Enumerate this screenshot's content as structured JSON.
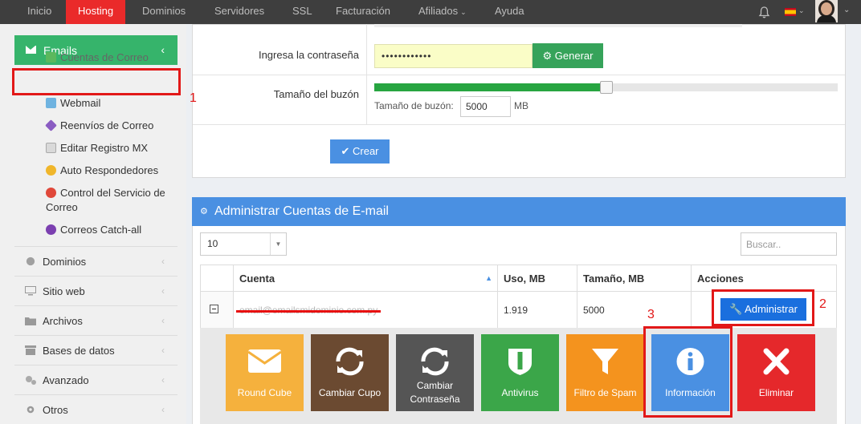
{
  "topnav": {
    "items": [
      "Inicio",
      "Hosting",
      "Dominios",
      "Servidores",
      "SSL",
      "Facturación",
      "Afiliados",
      "Ayuda"
    ],
    "active": "Hosting"
  },
  "sidebar": {
    "section": "Emails",
    "subitems": [
      "Cuentas de Correo",
      "Webmail",
      "Reenvíos de Correo",
      "Editar Registro MX",
      "Auto Respondedores",
      "Control del Servicio de Correo",
      "Correos Catch-all"
    ],
    "items": [
      "Dominios",
      "Sitio web",
      "Archivos",
      "Bases de datos",
      "Avanzado",
      "Otros"
    ]
  },
  "form": {
    "password_label": "Ingresa la contraseña",
    "password_value": "••••••••••••",
    "generate_label": "Generar",
    "mailbox_label": "Tamaño del buzón",
    "mailbox_size_label": "Tamaño de buzón:",
    "mailbox_size_value": "5000",
    "mailbox_unit": "MB",
    "mailbox_slider_fraction": 0.5,
    "create_label": "Crear"
  },
  "panel": {
    "title": "Administrar Cuentas de E-mail",
    "page_size": "10",
    "search_placeholder": "Buscar..",
    "columns": [
      "Cuenta",
      "Uso, MB",
      "Tamaño, MB",
      "Acciones"
    ],
    "rows": [
      {
        "account": "email@emailsmidominio.com.py",
        "usage": "1.919",
        "size": "5000",
        "action": "Administrar"
      }
    ]
  },
  "tiles": [
    {
      "label": "Round Cube",
      "color": "#f5b13d",
      "icon": "envelope-icon"
    },
    {
      "label": "Cambiar Cupo",
      "color": "#6b4a31",
      "icon": "refresh-icon"
    },
    {
      "label": "Cambiar Contraseña",
      "color": "#555555",
      "icon": "refresh-icon"
    },
    {
      "label": "Antivirus",
      "color": "#3ba649",
      "icon": "shield-icon"
    },
    {
      "label": "Filtro de Spam",
      "color": "#f4931e",
      "icon": "filter-icon"
    },
    {
      "label": "Información",
      "color": "#4a90e2",
      "icon": "info-icon"
    },
    {
      "label": "Eliminar",
      "color": "#e5282b",
      "icon": "close-icon"
    }
  ],
  "annotations": [
    "1",
    "2",
    "3"
  ],
  "colors": {
    "accent": "#36b46b",
    "nav_active": "#ea2a2a",
    "highlight": "#e21818",
    "primary": "#4a90e2"
  }
}
